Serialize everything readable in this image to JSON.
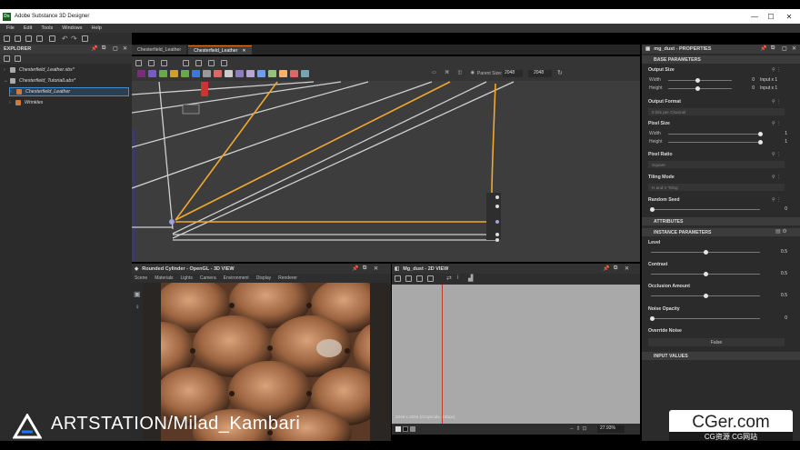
{
  "window": {
    "title": "Adobe Substance 3D Designer",
    "logo": "Ds",
    "controls": [
      "—",
      "☐",
      "✕"
    ]
  },
  "menu": [
    "File",
    "Edit",
    "Tools",
    "Windows",
    "Help"
  ],
  "explorer": {
    "title": "EXPLORER",
    "items": [
      {
        "label": "Chesterfield_Leather.sbs*",
        "indent": 0
      },
      {
        "label": "Chesterfield_TutorialLabs*",
        "indent": 0
      },
      {
        "label": "Chesterfield_Leather",
        "indent": 1,
        "selected": true
      },
      {
        "label": "Wrinkles",
        "indent": 1
      }
    ]
  },
  "graph": {
    "tabs": [
      "Chesterfield_Leather",
      "Chesterfield_Leather"
    ],
    "parent_size_label": "Parent Size:",
    "parent_size": "2048",
    "size": "2048",
    "chip_colors": [
      "#7a2e7a",
      "#7a5cbf",
      "#6aa84f",
      "#c9a227",
      "#6aa84f",
      "#3c78d8",
      "#999999",
      "#e06666",
      "#cccccc",
      "#8e7cc3",
      "#b4a7d6",
      "#6d9eeb",
      "#93c47d",
      "#f6b26b",
      "#e06666",
      "#76a5af"
    ]
  },
  "view3d": {
    "title": "Rounded Cylinder - OpenGL - 3D VIEW",
    "menu": [
      "Scene",
      "Materials",
      "Lights",
      "Camera",
      "Environment",
      "Display",
      "Renderer"
    ]
  },
  "view2d": {
    "title": "Mg_dust - 2D VIEW",
    "status": "2048 x 2048 (Grayscale, 16bpc)",
    "zoom": "27.93%"
  },
  "properties": {
    "title": "mg_dust - PROPERTIES",
    "sections": {
      "base": "BASE PARAMETERS",
      "attributes": "ATTRIBUTES",
      "instance": "INSTANCE PARAMETERS",
      "input": "INPUT VALUES"
    },
    "output_size": {
      "label": "Output Size",
      "width_label": "Width",
      "height_label": "Height",
      "width": "0",
      "height": "0",
      "width_mode": "Input x 1",
      "height_mode": "Input x 1"
    },
    "output_format": {
      "label": "Output Format",
      "value": "8 bits per Channel"
    },
    "pixel_size": {
      "label": "Pixel Size",
      "width_label": "Width",
      "height_label": "Height",
      "width": "1",
      "height": "1"
    },
    "pixel_ratio": {
      "label": "Pixel Ratio",
      "value": "Square"
    },
    "tiling_mode": {
      "label": "Tiling Mode",
      "value": "H and V Tiling"
    },
    "random_seed": {
      "label": "Random Seed",
      "value": "0"
    },
    "level": {
      "label": "Level",
      "value": "0.5"
    },
    "contrast": {
      "label": "Contrast",
      "value": "0.5"
    },
    "occlusion": {
      "label": "Occlusion Amount",
      "value": "0.5"
    },
    "noise_opacity": {
      "label": "Noise Opacity",
      "value": "0"
    },
    "override_noise": {
      "label": "Override Noise",
      "value": "False"
    }
  },
  "watermarks": {
    "artstation": "ARTSTATION/Milad_Kambari",
    "cger": "CGer.com",
    "cger_sub": "CG资源 CG网站"
  }
}
